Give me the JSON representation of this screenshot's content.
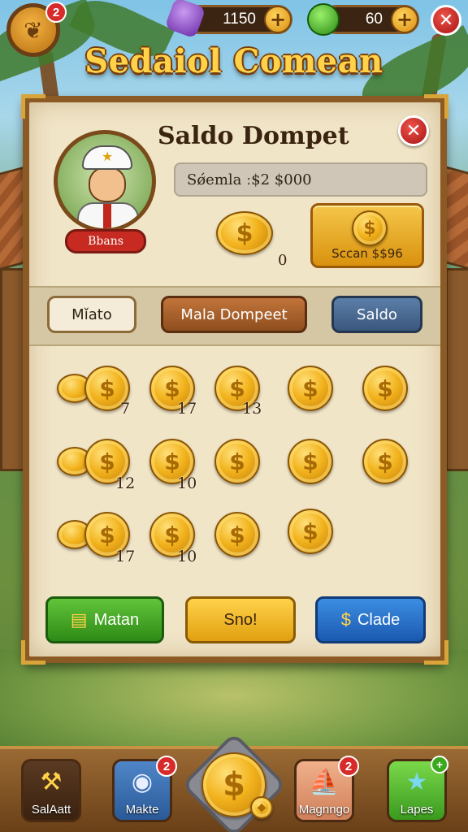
{
  "hud": {
    "avatar_badge": "2",
    "gems_value": "1150",
    "gems_plus": "+",
    "energy_value": "60",
    "energy_plus": "+",
    "close": "✕"
  },
  "game_title": "Sedaiol Comean",
  "panel": {
    "title": "Saldo Dompet",
    "close": "✕",
    "character_name": "Bbans",
    "balance": "Sǿemla ː$2 $000",
    "big_coin_amount": "0",
    "scan_button_label": "Sccan $$96"
  },
  "tabs": [
    {
      "label": "Mǐato"
    },
    {
      "label": "Mala Dompeet"
    },
    {
      "label": "Saldo"
    }
  ],
  "coin_grid": {
    "symbol": "$",
    "counts": [
      "7",
      "17",
      "13",
      "12",
      "10",
      "17",
      "10"
    ]
  },
  "actions": {
    "green_label": "Matan",
    "yellow_label": "Sno!",
    "blue_label": "Clade",
    "blue_icon": "$"
  },
  "bottom_nav": [
    {
      "label": "SalAatt",
      "badge": ""
    },
    {
      "label": "Makte",
      "badge": "2"
    },
    {
      "label": "",
      "badge": ""
    },
    {
      "label": "Magnngo",
      "badge": "2"
    },
    {
      "label": "Lapes",
      "badge": ""
    }
  ],
  "colors": {
    "panel_bg": "#f1e5c8",
    "frame": "#8c5a24",
    "gold": "#f2b31d",
    "green": "#2e8a16",
    "blue": "#1a59b0",
    "red": "#d72a2a"
  }
}
